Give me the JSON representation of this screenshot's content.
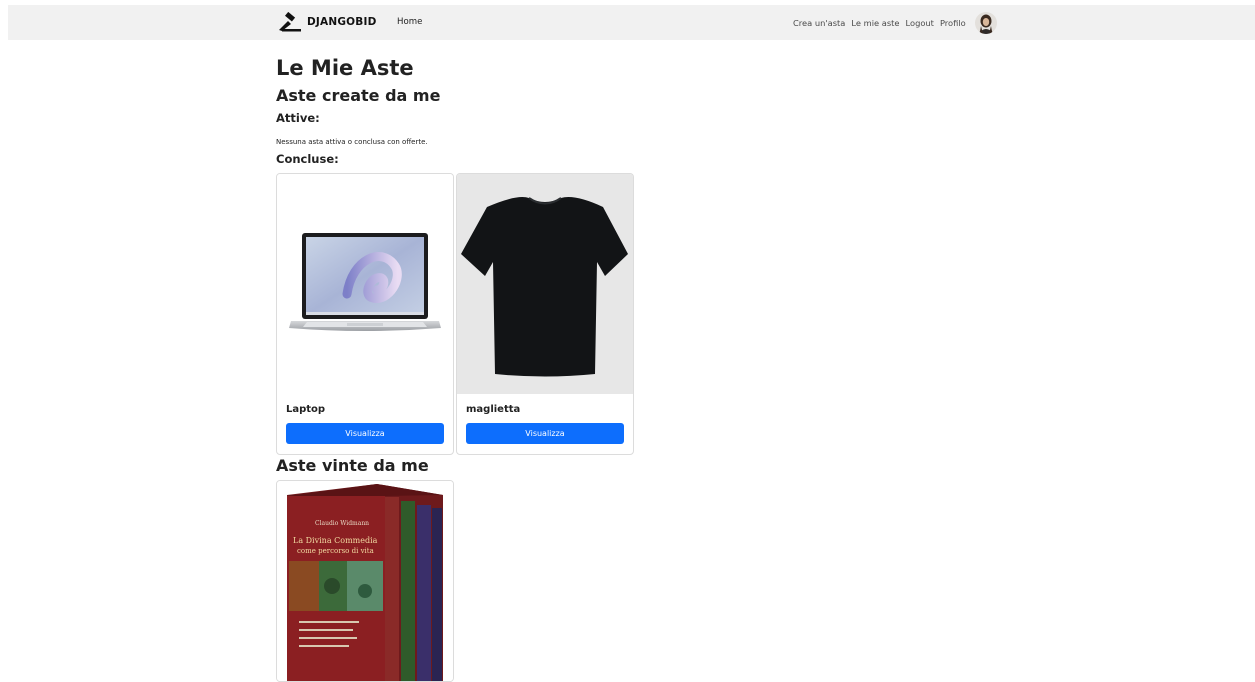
{
  "navbar": {
    "brand": "DJANGOBID",
    "home_label": "Home",
    "links": {
      "create": "Crea un'asta",
      "my_auctions": "Le mie aste",
      "logout": "Logout",
      "profile": "Profilo"
    }
  },
  "page": {
    "title": "Le Mie Aste",
    "created_section": "Aste create da me",
    "active_label": "Attive:",
    "no_active_msg": "Nessuna asta attiva o conclusa con offerte.",
    "closed_label": "Concluse:",
    "won_section": "Aste vinte da me"
  },
  "closed_auctions": [
    {
      "title": "Laptop",
      "button": "Visualizza",
      "image": "laptop-image"
    },
    {
      "title": "maglietta",
      "button": "Visualizza",
      "image": "tshirt-image"
    }
  ],
  "won_auctions": [
    {
      "title": "",
      "button": "",
      "image": "book-box-image"
    }
  ],
  "colors": {
    "navbar_bg": "#f1f1f1",
    "primary": "#0d6efd"
  }
}
